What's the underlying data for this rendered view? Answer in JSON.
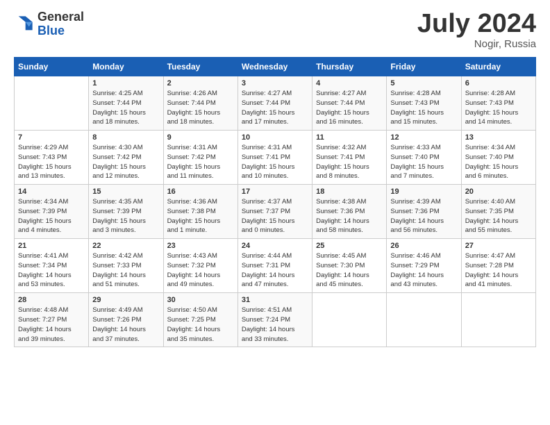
{
  "header": {
    "logo_general": "General",
    "logo_blue": "Blue",
    "month_title": "July 2024",
    "location": "Nogir, Russia"
  },
  "days_of_week": [
    "Sunday",
    "Monday",
    "Tuesday",
    "Wednesday",
    "Thursday",
    "Friday",
    "Saturday"
  ],
  "weeks": [
    [
      {
        "day": "",
        "info": ""
      },
      {
        "day": "1",
        "info": "Sunrise: 4:25 AM\nSunset: 7:44 PM\nDaylight: 15 hours\nand 18 minutes."
      },
      {
        "day": "2",
        "info": "Sunrise: 4:26 AM\nSunset: 7:44 PM\nDaylight: 15 hours\nand 18 minutes."
      },
      {
        "day": "3",
        "info": "Sunrise: 4:27 AM\nSunset: 7:44 PM\nDaylight: 15 hours\nand 17 minutes."
      },
      {
        "day": "4",
        "info": "Sunrise: 4:27 AM\nSunset: 7:44 PM\nDaylight: 15 hours\nand 16 minutes."
      },
      {
        "day": "5",
        "info": "Sunrise: 4:28 AM\nSunset: 7:43 PM\nDaylight: 15 hours\nand 15 minutes."
      },
      {
        "day": "6",
        "info": "Sunrise: 4:28 AM\nSunset: 7:43 PM\nDaylight: 15 hours\nand 14 minutes."
      }
    ],
    [
      {
        "day": "7",
        "info": "Sunrise: 4:29 AM\nSunset: 7:43 PM\nDaylight: 15 hours\nand 13 minutes."
      },
      {
        "day": "8",
        "info": "Sunrise: 4:30 AM\nSunset: 7:42 PM\nDaylight: 15 hours\nand 12 minutes."
      },
      {
        "day": "9",
        "info": "Sunrise: 4:31 AM\nSunset: 7:42 PM\nDaylight: 15 hours\nand 11 minutes."
      },
      {
        "day": "10",
        "info": "Sunrise: 4:31 AM\nSunset: 7:41 PM\nDaylight: 15 hours\nand 10 minutes."
      },
      {
        "day": "11",
        "info": "Sunrise: 4:32 AM\nSunset: 7:41 PM\nDaylight: 15 hours\nand 8 minutes."
      },
      {
        "day": "12",
        "info": "Sunrise: 4:33 AM\nSunset: 7:40 PM\nDaylight: 15 hours\nand 7 minutes."
      },
      {
        "day": "13",
        "info": "Sunrise: 4:34 AM\nSunset: 7:40 PM\nDaylight: 15 hours\nand 6 minutes."
      }
    ],
    [
      {
        "day": "14",
        "info": "Sunrise: 4:34 AM\nSunset: 7:39 PM\nDaylight: 15 hours\nand 4 minutes."
      },
      {
        "day": "15",
        "info": "Sunrise: 4:35 AM\nSunset: 7:39 PM\nDaylight: 15 hours\nand 3 minutes."
      },
      {
        "day": "16",
        "info": "Sunrise: 4:36 AM\nSunset: 7:38 PM\nDaylight: 15 hours\nand 1 minute."
      },
      {
        "day": "17",
        "info": "Sunrise: 4:37 AM\nSunset: 7:37 PM\nDaylight: 15 hours\nand 0 minutes."
      },
      {
        "day": "18",
        "info": "Sunrise: 4:38 AM\nSunset: 7:36 PM\nDaylight: 14 hours\nand 58 minutes."
      },
      {
        "day": "19",
        "info": "Sunrise: 4:39 AM\nSunset: 7:36 PM\nDaylight: 14 hours\nand 56 minutes."
      },
      {
        "day": "20",
        "info": "Sunrise: 4:40 AM\nSunset: 7:35 PM\nDaylight: 14 hours\nand 55 minutes."
      }
    ],
    [
      {
        "day": "21",
        "info": "Sunrise: 4:41 AM\nSunset: 7:34 PM\nDaylight: 14 hours\nand 53 minutes."
      },
      {
        "day": "22",
        "info": "Sunrise: 4:42 AM\nSunset: 7:33 PM\nDaylight: 14 hours\nand 51 minutes."
      },
      {
        "day": "23",
        "info": "Sunrise: 4:43 AM\nSunset: 7:32 PM\nDaylight: 14 hours\nand 49 minutes."
      },
      {
        "day": "24",
        "info": "Sunrise: 4:44 AM\nSunset: 7:31 PM\nDaylight: 14 hours\nand 47 minutes."
      },
      {
        "day": "25",
        "info": "Sunrise: 4:45 AM\nSunset: 7:30 PM\nDaylight: 14 hours\nand 45 minutes."
      },
      {
        "day": "26",
        "info": "Sunrise: 4:46 AM\nSunset: 7:29 PM\nDaylight: 14 hours\nand 43 minutes."
      },
      {
        "day": "27",
        "info": "Sunrise: 4:47 AM\nSunset: 7:28 PM\nDaylight: 14 hours\nand 41 minutes."
      }
    ],
    [
      {
        "day": "28",
        "info": "Sunrise: 4:48 AM\nSunset: 7:27 PM\nDaylight: 14 hours\nand 39 minutes."
      },
      {
        "day": "29",
        "info": "Sunrise: 4:49 AM\nSunset: 7:26 PM\nDaylight: 14 hours\nand 37 minutes."
      },
      {
        "day": "30",
        "info": "Sunrise: 4:50 AM\nSunset: 7:25 PM\nDaylight: 14 hours\nand 35 minutes."
      },
      {
        "day": "31",
        "info": "Sunrise: 4:51 AM\nSunset: 7:24 PM\nDaylight: 14 hours\nand 33 minutes."
      },
      {
        "day": "",
        "info": ""
      },
      {
        "day": "",
        "info": ""
      },
      {
        "day": "",
        "info": ""
      }
    ]
  ]
}
